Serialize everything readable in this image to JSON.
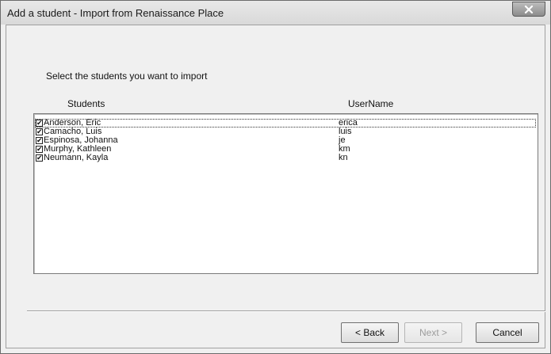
{
  "window": {
    "title": "Add a student - Import from Renaissance Place",
    "close_glyph": "x"
  },
  "content": {
    "instruction": "Select the students you want to import",
    "columns": {
      "students": "Students",
      "username": "UserName"
    },
    "students": [
      {
        "name": "Anderson, Eric",
        "username": "erica",
        "checked": true,
        "focused": true
      },
      {
        "name": "Camacho, Luis",
        "username": "luis",
        "checked": true
      },
      {
        "name": "Espinosa, Johanna",
        "username": "je",
        "checked": true
      },
      {
        "name": "Murphy, Kathleen",
        "username": "km",
        "checked": true
      },
      {
        "name": "Neumann, Kayla",
        "username": "kn",
        "checked": true
      }
    ],
    "check_glyph": "✔"
  },
  "buttons": {
    "back": "< Back",
    "next": "Next >",
    "cancel": "Cancel"
  },
  "icons": {
    "close": "close-icon",
    "checkbox": "checkbox-checked-icon"
  }
}
